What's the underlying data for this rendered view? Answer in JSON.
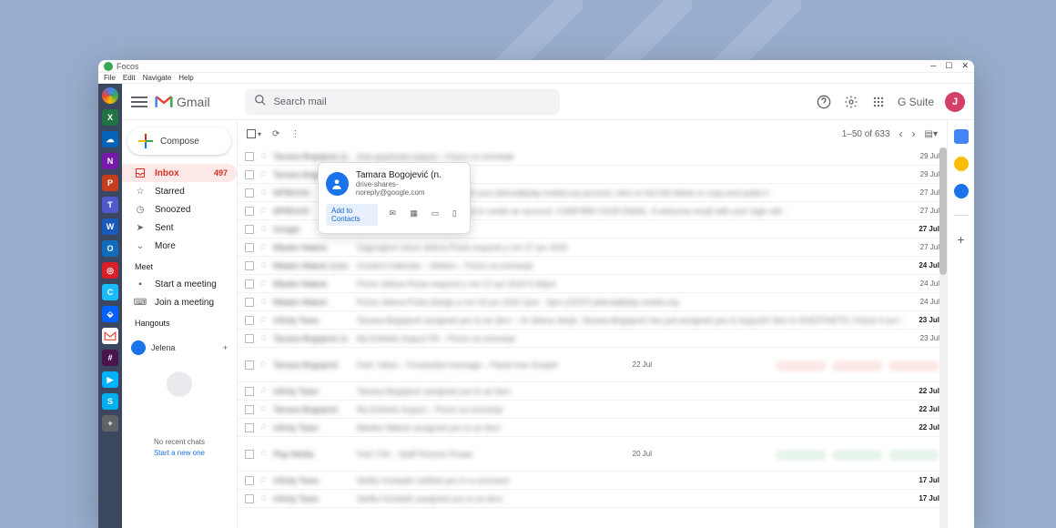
{
  "window": {
    "title": "Focos",
    "menu": [
      "File",
      "Edit",
      "Navigate",
      "Help"
    ]
  },
  "header": {
    "logo": "Gmail",
    "search_placeholder": "Search mail",
    "suite": "G Suite",
    "avatar_letter": "J"
  },
  "sidebar": {
    "compose": "Compose",
    "items": [
      {
        "icon": "inbox",
        "label": "Inbox",
        "count": "497",
        "active": true
      },
      {
        "icon": "star",
        "label": "Starred"
      },
      {
        "icon": "clock",
        "label": "Snoozed"
      },
      {
        "icon": "send",
        "label": "Sent"
      },
      {
        "icon": "more",
        "label": "More"
      }
    ],
    "meet": {
      "title": "Meet",
      "start": "Start a meeting",
      "join": "Join a meeting"
    },
    "hangouts": {
      "title": "Hangouts",
      "user": "Jelena",
      "nochats": "No recent chats",
      "startnew": "Start a new one"
    }
  },
  "toolbar": {
    "range": "1–50 of 633"
  },
  "rows": [
    {
      "sender": "Tamara Bogojević (n.",
      "subject": "Arta apartmani avgust – Pozivi za snimanje",
      "date": "29 Jul"
    },
    {
      "sender": "Tamara Bogojević (n.",
      "subject": "",
      "date": "29 Jul"
    },
    {
      "sender": "WPBOOK",
      "subject": "To create your new password for your jelena@play-media.org account, click on the link below or copy and paste it",
      "date": "27 Jul"
    },
    {
      "sender": "WPBOOK",
      "subject": "Please verify your email address to create an account. CONFIRM YOUR EMAIL. A welcome email with your login will…",
      "date": "27 Jul"
    },
    {
      "sender": "Google",
      "subject": "",
      "date": "27 Jul",
      "unread": true
    },
    {
      "sender": "Mladen Maksic",
      "subject": "Zagorajevo sreca Jelena Posta respond y rmr 27 jun 2020",
      "date": "27 Jul"
    },
    {
      "sender": "Mladen Maksic (com.",
      "subject": "Content Calendar – Writers – Pozivi za snimanje",
      "date": "24 Jul",
      "unread": true
    },
    {
      "sender": "Mladen Maksic",
      "subject": "Pozivi Jelena Posta respond y rmr 27 jun 2020 5:30pm",
      "date": "24 Jul"
    },
    {
      "sender": "Mladen Maksic",
      "subject": "Pozivi Jelena Posta disegn y rmr 04 jun 2020 1pm - 3pm (CEST) jelena@play-media.org",
      "date": "24 Jul"
    },
    {
      "sender": "Infinity Team",
      "subject": "Tamara Bogojević assigned you to an item – Hi Jelena Janjić, Tamara Bogojević has just assigned you to Avgust!!! item in AHESTHETIC Check it out Cheers, Infinity Team © 202…",
      "date": "23 Jul",
      "unread": true
    },
    {
      "sender": "Tamara Bogojević (n.",
      "subject": "My Esthetic Avgust FB – Pozivi za snimanje",
      "date": "23 Jul"
    },
    {
      "sender": "Tamara Bogojević",
      "subject": "Fwd: Video – Forwarded message – Paola Ivan Gospel",
      "date": "22 Jul",
      "tall": true,
      "attred": true
    },
    {
      "sender": "Infinity Team",
      "subject": "Tamara Bogojević assigned you to an item",
      "date": "22 Jul",
      "unread": true
    },
    {
      "sender": "Tamara Bogojević",
      "subject": "My Esthetic Avgust – Pozivi za snimanje",
      "date": "22 Jul",
      "unread": true
    },
    {
      "sender": "Infinity Team",
      "subject": "Mladen Maksic assigned you to an item",
      "date": "22 Jul",
      "unread": true
    },
    {
      "sender": "Play Media",
      "subject": "Fwd: FW – Staff Pictures Posao",
      "date": "20 Jul",
      "tall": true,
      "attgreen": true
    },
    {
      "sender": "Infinity Team",
      "subject": "Stefko Kostadić notified you in a comment",
      "date": "17 Jul",
      "unread": true
    },
    {
      "sender": "Infinity Team",
      "subject": "Stefko Kostadić assigned you to an item",
      "date": "17 Jul",
      "unread": true
    }
  ],
  "hover": {
    "name": "Tamara Bogojević (n.",
    "email": "drive-shares-noreply@google.com",
    "add": "Add to Contacts"
  },
  "rail_apps": [
    "X",
    "O",
    "N",
    "P",
    "V",
    "W",
    "OL",
    "A",
    "C",
    "D",
    "G",
    "S",
    "B",
    "Sk",
    "+"
  ]
}
